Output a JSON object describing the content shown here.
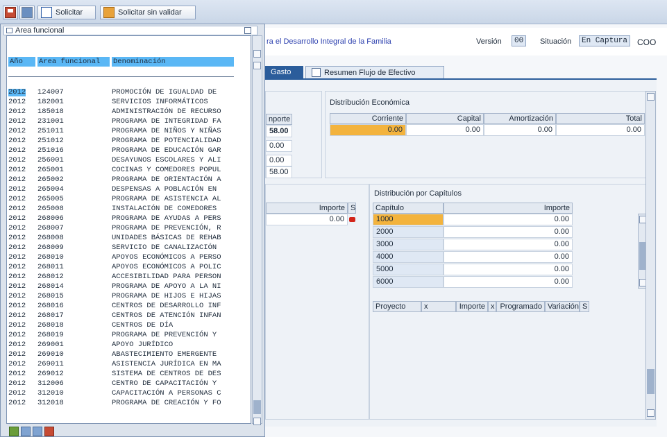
{
  "toolbar": {
    "request_label": "Solicitar",
    "request_no_validate_label": "Solicitar sin validar"
  },
  "header": {
    "title_partial": "ra el Desarrollo Integral de la Familia",
    "version_label": "Versión",
    "version_value": "00",
    "status_label": "Situación",
    "status_value": "En Captura",
    "status_code": "COO"
  },
  "tabs": [
    {
      "label": "Gasto",
      "active": true
    },
    {
      "label": "Resumen Flujo de Efectivo",
      "active": false
    }
  ],
  "left_stub": {
    "header": "nporte",
    "values": [
      "58.00",
      "0.00",
      "0.00",
      "58.00"
    ]
  },
  "dist_economica": {
    "title": "Distribución Económica",
    "columns": [
      "Corriente",
      "Capital",
      "Amortización",
      "Total"
    ],
    "values": [
      "0.00",
      "0.00",
      "0.00",
      "0.00"
    ]
  },
  "importe_grid": {
    "header": "Importe",
    "s_header": "S",
    "value": "0.00"
  },
  "dist_capitulos": {
    "title": "Distribución por Capítulos",
    "columns": [
      "Capítulo",
      "Importe"
    ],
    "rows": [
      {
        "capitulo": "1000",
        "importe": "0.00"
      },
      {
        "capitulo": "2000",
        "importe": "0.00"
      },
      {
        "capitulo": "3000",
        "importe": "0.00"
      },
      {
        "capitulo": "4000",
        "importe": "0.00"
      },
      {
        "capitulo": "5000",
        "importe": "0.00"
      },
      {
        "capitulo": "6000",
        "importe": "0.00"
      }
    ]
  },
  "proyecto_grid": {
    "columns": [
      "Proyecto",
      "x",
      "Importe",
      "x",
      "Programado",
      "Variación",
      "S"
    ]
  },
  "popup": {
    "title": "Area funcional",
    "columns": [
      "Año",
      "Area funcional",
      "Denominación"
    ],
    "rows": [
      {
        "year": "2012",
        "code": "124007",
        "name": "PROMOCIÓN DE IGUALDAD DE"
      },
      {
        "year": "2012",
        "code": "182001",
        "name": "SERVICIOS INFORMÁTICOS"
      },
      {
        "year": "2012",
        "code": "185018",
        "name": "ADMINISTRACIÓN DE RECURSO"
      },
      {
        "year": "2012",
        "code": "231001",
        "name": "PROGRAMA DE INTEGRIDAD FA"
      },
      {
        "year": "2012",
        "code": "251011",
        "name": "PROGRAMA DE NIÑOS Y NIÑAS"
      },
      {
        "year": "2012",
        "code": "251012",
        "name": "PROGRAMA DE POTENCIALIDAD"
      },
      {
        "year": "2012",
        "code": "251016",
        "name": "PROGRAMA DE EDUCACIÓN GAR"
      },
      {
        "year": "2012",
        "code": "256001",
        "name": "DESAYUNOS ESCOLARES Y ALI"
      },
      {
        "year": "2012",
        "code": "265001",
        "name": "COCINAS Y COMEDORES POPUL"
      },
      {
        "year": "2012",
        "code": "265002",
        "name": "PROGRAMA DE ORIENTACIÓN A"
      },
      {
        "year": "2012",
        "code": "265004",
        "name": "DESPENSAS A POBLACIÓN EN"
      },
      {
        "year": "2012",
        "code": "265005",
        "name": "PROGRAMA DE ASISTENCIA AL"
      },
      {
        "year": "2012",
        "code": "265008",
        "name": "INSTALACIÓN DE COMEDORES"
      },
      {
        "year": "2012",
        "code": "268006",
        "name": "PROGRAMA DE AYUDAS A PERS"
      },
      {
        "year": "2012",
        "code": "268007",
        "name": "PROGRAMA DE PREVENCIÓN, R"
      },
      {
        "year": "2012",
        "code": "268008",
        "name": "UNIDADES BÁSICAS DE REHAB"
      },
      {
        "year": "2012",
        "code": "268009",
        "name": "SERVICIO DE CANALIZACIÓN"
      },
      {
        "year": "2012",
        "code": "268010",
        "name": "APOYOS ECONÓMICOS A PERSO"
      },
      {
        "year": "2012",
        "code": "268011",
        "name": "APOYOS ECONÓMICOS A POLIC"
      },
      {
        "year": "2012",
        "code": "268012",
        "name": "ACCESIBILIDAD PARA PERSON"
      },
      {
        "year": "2012",
        "code": "268014",
        "name": "PROGRAMA DE APOYO A LA NI"
      },
      {
        "year": "2012",
        "code": "268015",
        "name": "PROGRAMA DE HIJOS E HIJAS"
      },
      {
        "year": "2012",
        "code": "268016",
        "name": "CENTROS DE DESARROLLO INF"
      },
      {
        "year": "2012",
        "code": "268017",
        "name": "CENTROS DE ATENCIÓN INFAN"
      },
      {
        "year": "2012",
        "code": "268018",
        "name": "CENTROS DE DÍA"
      },
      {
        "year": "2012",
        "code": "268019",
        "name": "PROGRAMA DE PREVENCIÓN Y"
      },
      {
        "year": "2012",
        "code": "269001",
        "name": "APOYO JURÍDICO"
      },
      {
        "year": "2012",
        "code": "269010",
        "name": "ABASTECIMIENTO EMERGENTE"
      },
      {
        "year": "2012",
        "code": "269011",
        "name": "ASISTENCIA JURÍDICA EN MA"
      },
      {
        "year": "2012",
        "code": "269012",
        "name": "SISTEMA DE CENTROS DE DES"
      },
      {
        "year": "2012",
        "code": "312006",
        "name": "CENTRO DE CAPACITACIÓN Y"
      },
      {
        "year": "2012",
        "code": "312010",
        "name": "CAPACITACIÓN A PERSONAS C"
      },
      {
        "year": "2012",
        "code": "312018",
        "name": "PROGRAMA DE CREACIÓN Y FO"
      }
    ]
  },
  "colors": {
    "accent": "#2b5d9b",
    "selected": "#f3b33d",
    "popup_header": "#5ab7f5"
  }
}
